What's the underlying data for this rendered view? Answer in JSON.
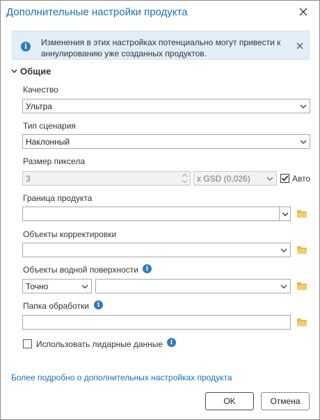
{
  "dialog": {
    "title": "Дополнительные настройки продукта"
  },
  "info": {
    "message": "Изменения в этих настройках потенциально могут привести к аннулированию уже созданных продуктов."
  },
  "group": {
    "label": "Общие"
  },
  "quality": {
    "label": "Качество",
    "value": "Ультра"
  },
  "scenario": {
    "label": "Тип сценария",
    "value": "Наклонный"
  },
  "pixel": {
    "label": "Размер пиксела",
    "value": "3",
    "unit": "x GSD (0,026)",
    "auto_label": "Авто",
    "auto_checked": true
  },
  "boundary": {
    "label": "Граница продукта",
    "value": ""
  },
  "correction": {
    "label": "Объекты корректировки",
    "value": ""
  },
  "water": {
    "label": "Объекты водной поверхности",
    "mode": "Точно",
    "value": ""
  },
  "processing": {
    "label": "Папка обработки",
    "value": ""
  },
  "lidar": {
    "label": "Использовать лидарные данные",
    "checked": false
  },
  "footer": {
    "link": "Более подробно о дополнительных настройках продукта",
    "ok": "OK",
    "cancel": "Отмена"
  },
  "colors": {
    "accent": "#1a6fb5",
    "info_bg": "#e1eef8",
    "folder": "#e8b84a"
  }
}
